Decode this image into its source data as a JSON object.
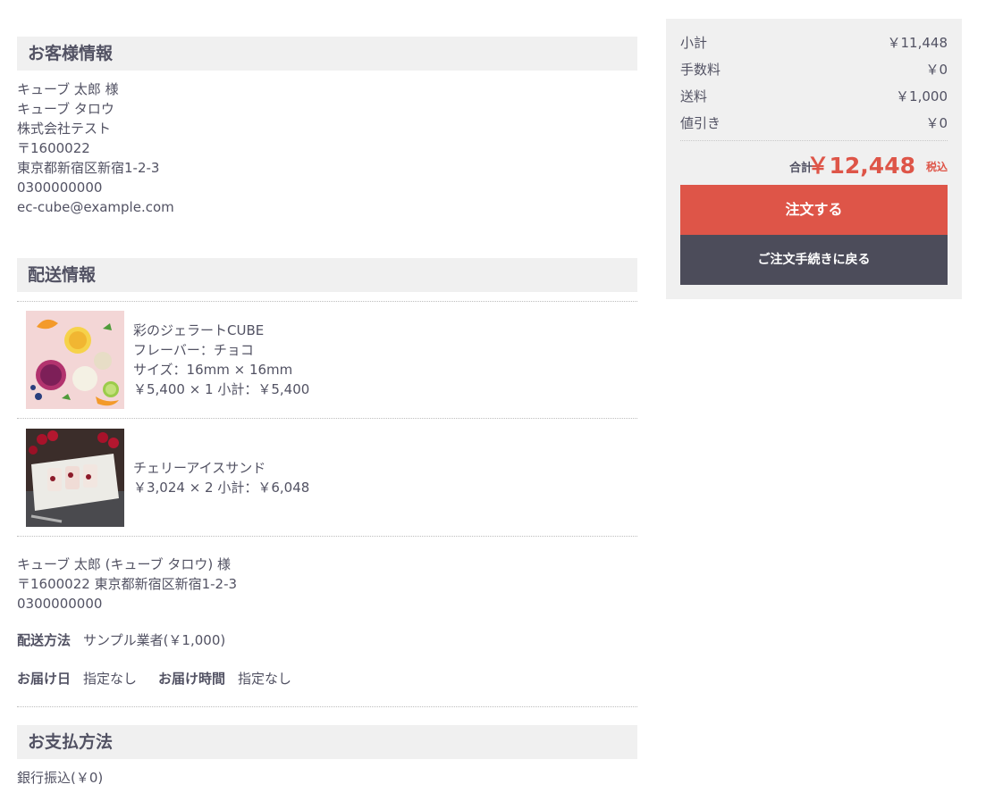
{
  "customer": {
    "heading": "お客様情報",
    "lines": [
      "キューブ 太郎 様",
      "キューブ タロウ",
      "株式会社テスト",
      "〒1600022",
      "東京都新宿区新宿1-2-3",
      "0300000000",
      "ec-cube@example.com"
    ]
  },
  "shipping": {
    "heading": "配送情報",
    "items": [
      {
        "lines": [
          "彩のジェラートCUBE",
          "フレーバー：チョコ",
          "サイズ：16mm × 16mm",
          "￥5,400 × 1  小計：￥5,400"
        ]
      },
      {
        "lines": [
          "チェリーアイスサンド",
          "￥3,024 × 2  小計：￥6,048"
        ]
      }
    ],
    "address_lines": [
      "キューブ 太郎 (キューブ タロウ) 様",
      "〒1600022 東京都新宿区新宿1-2-3",
      "0300000000"
    ],
    "method_label": "配送方法",
    "method_value": "サンプル業者(￥1,000)",
    "date_label": "お届け日",
    "date_value": "指定なし",
    "time_label": "お届け時間",
    "time_value": "指定なし"
  },
  "payment": {
    "heading": "お支払方法",
    "value": "銀行振込(￥0)"
  },
  "summary": {
    "rows": [
      {
        "label": "小計",
        "value": "￥11,448"
      },
      {
        "label": "手数料",
        "value": "￥0"
      },
      {
        "label": "送料",
        "value": "￥1,000"
      },
      {
        "label": "値引き",
        "value": "￥0"
      }
    ],
    "total_label": "合計",
    "total_value": "￥12,448",
    "tax_label": "税込",
    "order_button": "注文する",
    "back_button": "ご注文手続きに戻る"
  },
  "colors": {
    "accent": "#de5548",
    "dark_button": "#4c4c5a",
    "panel_bg": "#f0f0f0",
    "text": "#525263"
  }
}
